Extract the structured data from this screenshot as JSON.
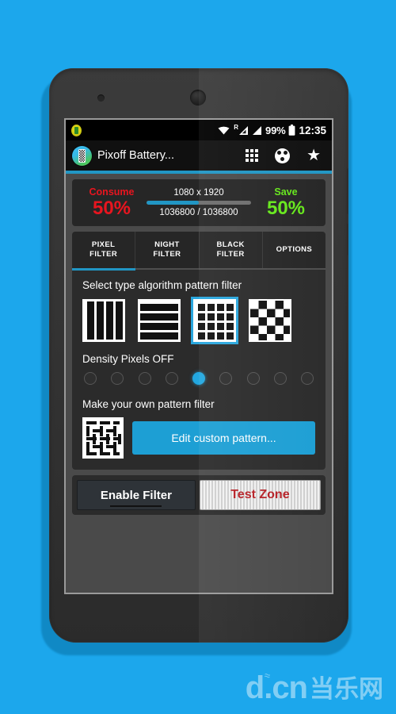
{
  "theme": {
    "page_bg": "#1CA7EC",
    "accent": "#2196c4",
    "consume_color": "#e8151f",
    "save_color": "#66e81b",
    "test_zone_color": "#b62026"
  },
  "status_bar": {
    "app_notification_icon": "battery-notification-icon",
    "wifi_icon": "wifi-icon",
    "roaming_label": "R",
    "signal_icon_1": "signal-bars-icon",
    "signal_icon_2": "signal-bars-icon",
    "battery_percent": "99%",
    "battery_icon": "battery-icon",
    "time": "12:35"
  },
  "toolbar": {
    "app_icon": "pixoff-app-icon",
    "title": "Pixoff Battery...",
    "actions": [
      {
        "name": "grid-icon",
        "label": ""
      },
      {
        "name": "reel-icon",
        "label": ""
      },
      {
        "name": "star-icon",
        "label": "★"
      }
    ]
  },
  "summary": {
    "consume_label": "Consume",
    "consume_value": "50%",
    "resolution": "1080 x 1920",
    "progress_percent": 50,
    "pixel_count": "1036800 / 1036800",
    "save_label": "Save",
    "save_value": "50%"
  },
  "tabs": {
    "items": [
      {
        "line1": "PIXEL",
        "line2": "FILTER",
        "selected": true
      },
      {
        "line1": "NIGHT",
        "line2": "FILTER",
        "selected": false
      },
      {
        "line1": "BLACK",
        "line2": "FILTER",
        "selected": false
      },
      {
        "line1": "OPTIONS",
        "line2": "",
        "selected": false
      }
    ]
  },
  "content": {
    "pattern_section_title": "Select type algorithm pattern filter",
    "patterns": [
      {
        "name": "vertical-stripes-pattern",
        "selected": false
      },
      {
        "name": "horizontal-stripes-pattern",
        "selected": false
      },
      {
        "name": "grid-pattern",
        "selected": true
      },
      {
        "name": "checkerboard-pattern",
        "selected": false
      }
    ],
    "density_title": "Density Pixels OFF",
    "density_steps": 9,
    "density_selected_index": 4,
    "custom_title": "Make your own pattern filter",
    "custom_thumb_name": "custom-weave-pattern",
    "edit_button_label": "Edit custom pattern..."
  },
  "bottom_bar": {
    "enable_label": "Enable Filter",
    "test_label": "Test Zone"
  },
  "watermark": {
    "primary": "d.cn",
    "secondary": "当乐网"
  }
}
